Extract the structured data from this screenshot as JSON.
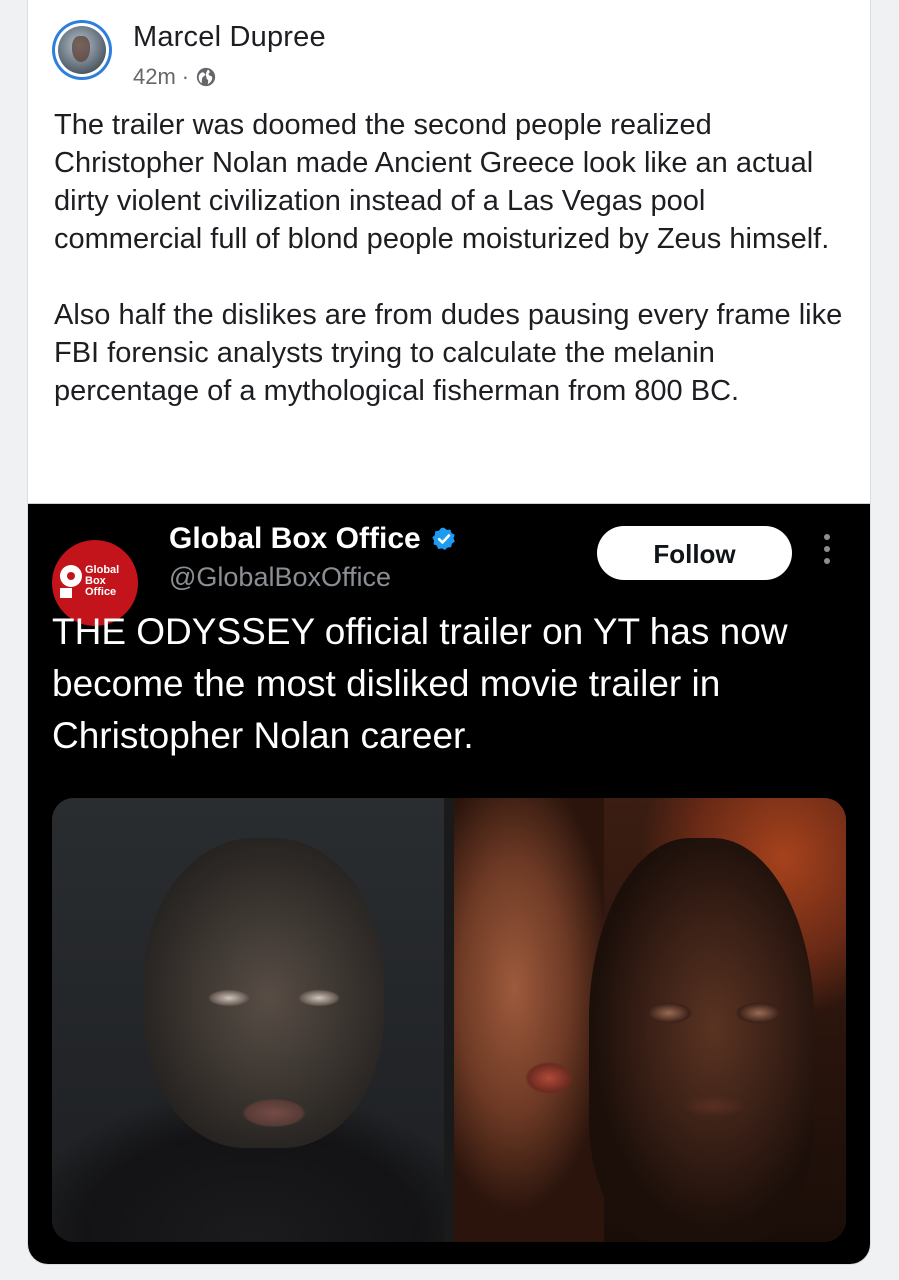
{
  "post": {
    "author": "Marcel Dupree",
    "time": "42m",
    "separator": "·",
    "privacy_icon": "globe-icon",
    "paragraphs": [
      "The trailer was doomed the second people realized Christopher Nolan made Ancient Greece look like an actual dirty violent civilization instead of a Las Vegas pool commercial full of blond people moisturized by Zeus himself.",
      "Also half the dislikes are from dudes pausing every frame like FBI forensic analysts trying to calculate the melanin percentage of a mythological fisherman from 800 BC."
    ]
  },
  "embed": {
    "logo": {
      "lines": [
        "Global",
        "Box",
        "Office"
      ],
      "color": "#c3141c"
    },
    "account_name": "Global Box Office",
    "verified_icon": "verified-badge-icon",
    "handle": "@GlobalBoxOffice",
    "follow_label": "Follow",
    "more_icon": "more-vertical-icon",
    "text": "THE ODYSSEY official trailer on YT has now become the most disliked movie trailer in Christopher Nolan career."
  },
  "colors": {
    "page_bg": "#f0f1f3",
    "card_bg": "#ffffff",
    "embed_bg": "#000000",
    "verified": "#1d9bf0",
    "avatar_ring": "#2d7fdd"
  }
}
